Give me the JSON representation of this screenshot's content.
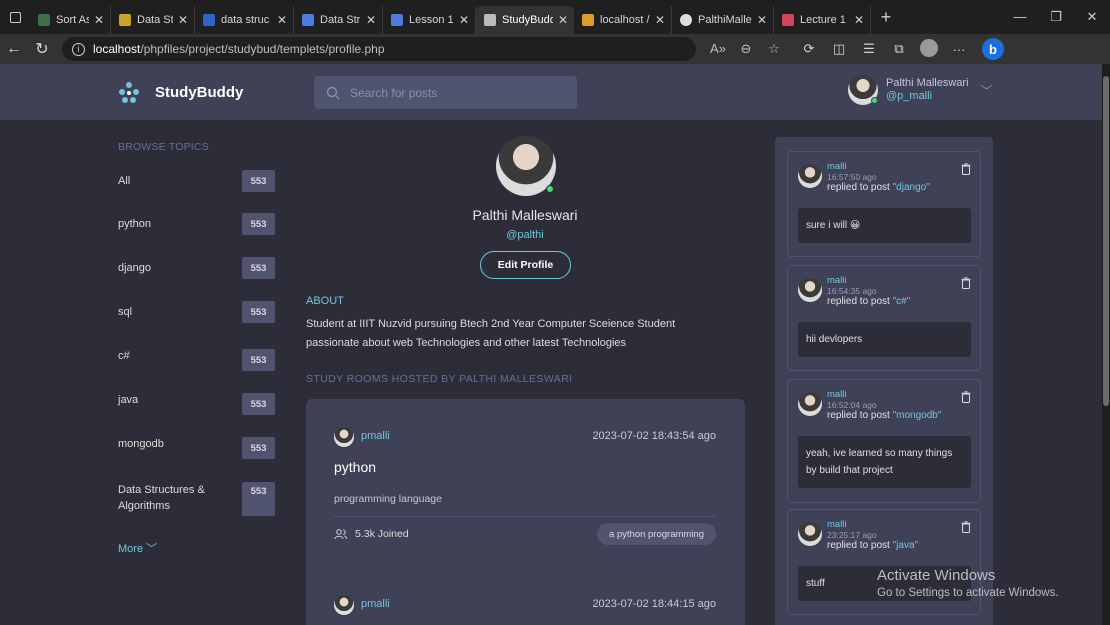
{
  "browser": {
    "tabs": [
      {
        "label": "Sort Ascen",
        "color": "#3c6f4a",
        "active": false
      },
      {
        "label": "Data Struc",
        "color": "#c9a227",
        "active": false
      },
      {
        "label": "data struc",
        "color": "#2e63c9",
        "active": false
      },
      {
        "label": "Data Struc",
        "color": "#4e7be0",
        "active": false
      },
      {
        "label": "Lesson 1 -",
        "color": "#4e7be0",
        "active": false
      },
      {
        "label": "StudyBudd",
        "color": "#bbbbbb",
        "active": true
      },
      {
        "label": "localhost /",
        "color": "#e09b2b",
        "active": false
      },
      {
        "label": "PalthiMalle",
        "color": "#dddddd",
        "active": false
      },
      {
        "label": "Lecture 1 -",
        "color": "#d8425a",
        "active": false
      }
    ],
    "new_tab": "+",
    "url_host": "localhost",
    "url_path": "/phpfiles/project/studybud/templets/profile.php"
  },
  "header": {
    "brand": "StudyBuddy",
    "search_placeholder": "Search for posts",
    "user_name": "Palthi Malleswari",
    "user_handle": "@p_malli"
  },
  "sidebar": {
    "title": "BROWSE TOPICS",
    "topics": [
      {
        "name": "All",
        "count": "553"
      },
      {
        "name": "python",
        "count": "553"
      },
      {
        "name": "django",
        "count": "553"
      },
      {
        "name": "sql",
        "count": "553"
      },
      {
        "name": "c#",
        "count": "553"
      },
      {
        "name": "java",
        "count": "553"
      },
      {
        "name": "mongodb",
        "count": "553"
      },
      {
        "name": "Data Structures & Algorithms",
        "count": "553"
      }
    ],
    "more": "More"
  },
  "profile": {
    "name": "Palthi Malleswari",
    "handle": "@palthi",
    "edit_label": "Edit Profile",
    "about_title": "ABOUT",
    "about_line1": "Student at IIIT Nuzvid pursuing Btech 2nd Year Computer Sceience Student",
    "about_line2": "passionate about web Technologies and other latest Technologies",
    "hosted_title": "STUDY ROOMS HOSTED BY PALTHI MALLESWARI"
  },
  "rooms": [
    {
      "host": "pmalli",
      "time": "2023-07-02 18:43:54 ago",
      "title": "python",
      "description": "programming language",
      "joined": "5.3k Joined",
      "topic": "a python programming"
    },
    {
      "host": "pmalli",
      "time": "2023-07-02 18:44:15 ago"
    }
  ],
  "activities": [
    {
      "user": "malli",
      "ago": "16:57:50 ago",
      "replied": "replied to post ",
      "post": "\"django\"",
      "body": "sure i will 😀"
    },
    {
      "user": "malli",
      "ago": "16:54:35 ago",
      "replied": "replied to post ",
      "post": "\"c#\"",
      "body": "hii devlopers"
    },
    {
      "user": "malli",
      "ago": "16:52:04 ago",
      "replied": "replied to post ",
      "post": "\"mongodb\"",
      "body": "yeah, ive learned so many things by build that project"
    },
    {
      "user": "malli",
      "ago": "23:25:17 ago",
      "replied": "replied to post ",
      "post": "\"java\"",
      "body": "stuff"
    }
  ],
  "watermark": {
    "line1": "Activate Windows",
    "line2": "Go to Settings to activate Windows."
  }
}
